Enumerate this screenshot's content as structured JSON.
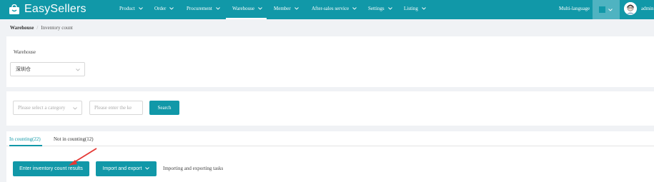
{
  "brand": {
    "name": "EasySellers",
    "accent": "#1198a8"
  },
  "nav": {
    "items": [
      {
        "label": "Product"
      },
      {
        "label": "Order"
      },
      {
        "label": "Procurement"
      },
      {
        "label": "Warehouse",
        "active": true
      },
      {
        "label": "Member"
      },
      {
        "label": "After-sales service"
      },
      {
        "label": "Settings"
      },
      {
        "label": "Listing"
      }
    ],
    "language_label": "Multi-language",
    "user_name": "admin"
  },
  "breadcrumb": {
    "section": "Warehouse",
    "page": "Inventory count"
  },
  "filters": {
    "warehouse_label": "Warehouse",
    "warehouse_value": "深圳仓",
    "category_placeholder": "Please select a category",
    "keyword_placeholder": "Please enter the ke",
    "search_label": "Search"
  },
  "tabs": [
    {
      "label": "In counting(22)",
      "active": true
    },
    {
      "label": "Not in counting(12)"
    }
  ],
  "actions": {
    "enter_results_label": "Enter inventory count results",
    "import_export_label": "Import and export",
    "tasks_link": "Importing and exporting tasks"
  },
  "icons": {
    "logo": "shopping-bag-icon",
    "dropdown": "chevron-down-icon",
    "annotation": "red-arrow-annotation"
  }
}
